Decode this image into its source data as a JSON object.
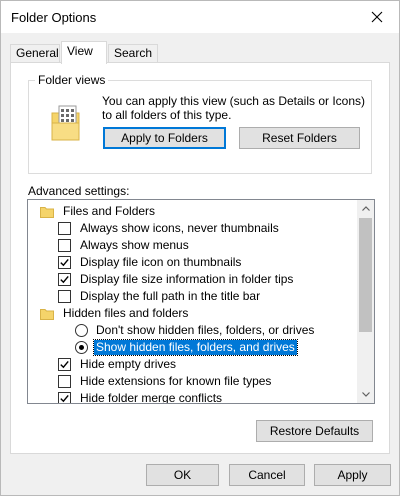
{
  "window": {
    "title": "Folder Options"
  },
  "tabs": [
    {
      "label": "General",
      "active": false
    },
    {
      "label": "View",
      "active": true
    },
    {
      "label": "Search",
      "active": false
    }
  ],
  "folder_views": {
    "legend": "Folder views",
    "description": "You can apply this view (such as Details or Icons) to all folders of this type.",
    "apply_button": "Apply to Folders",
    "reset_button": "Reset Folders"
  },
  "advanced": {
    "label": "Advanced settings:",
    "items": [
      {
        "type": "folder",
        "label": "Files and Folders"
      },
      {
        "type": "checkbox",
        "label": "Always show icons, never thumbnails",
        "checked": false
      },
      {
        "type": "checkbox",
        "label": "Always show menus",
        "checked": false
      },
      {
        "type": "checkbox",
        "label": "Display file icon on thumbnails",
        "checked": true
      },
      {
        "type": "checkbox",
        "label": "Display file size information in folder tips",
        "checked": true
      },
      {
        "type": "checkbox",
        "label": "Display the full path in the title bar",
        "checked": false
      },
      {
        "type": "folder",
        "label": "Hidden files and folders"
      },
      {
        "type": "radio",
        "label": "Don't show hidden files, folders, or drives",
        "checked": false
      },
      {
        "type": "radio",
        "label": "Show hidden files, folders, and drives",
        "checked": true,
        "selected": true
      },
      {
        "type": "checkbox",
        "label": "Hide empty drives",
        "checked": true
      },
      {
        "type": "checkbox",
        "label": "Hide extensions for known file types",
        "checked": false
      },
      {
        "type": "checkbox",
        "label": "Hide folder merge conflicts",
        "checked": true
      }
    ]
  },
  "restore_button": "Restore Defaults",
  "footer": {
    "ok": "OK",
    "cancel": "Cancel",
    "apply": "Apply"
  },
  "icons": {
    "close": "close-icon",
    "folder": "folder-icon",
    "folder_view": "folder-view-icon",
    "check": "checkmark-icon",
    "scroll_up": "chevron-up-icon",
    "scroll_down": "chevron-down-icon"
  },
  "colors": {
    "selection": "#0078d7",
    "folder": "#f5d46a"
  }
}
